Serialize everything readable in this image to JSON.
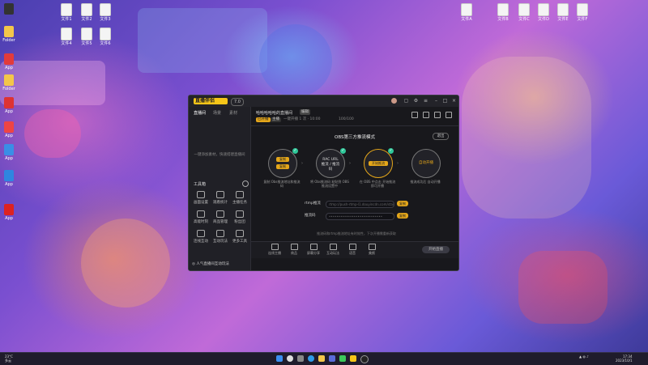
{
  "desktop": {
    "icons_left": [
      {
        "label": "",
        "kind": "app",
        "color": "#333333"
      },
      {
        "label": "Folder",
        "kind": "folder",
        "color": "#f3c64a"
      },
      {
        "label": "App",
        "kind": "app",
        "color": "#e23b3b"
      },
      {
        "label": "Folder",
        "kind": "folder",
        "color": "#f3c64a"
      },
      {
        "label": "App",
        "kind": "app",
        "color": "#d33"
      },
      {
        "label": "App",
        "kind": "app",
        "color": "#e44"
      },
      {
        "label": "App",
        "kind": "app",
        "color": "#3a8ee6"
      },
      {
        "label": "App",
        "kind": "app",
        "color": "#2f86e0"
      },
      {
        "label": "App",
        "kind": "app",
        "color": "#d22"
      }
    ],
    "icons_top": [
      "文件1",
      "文件2",
      "文件3",
      "文件4",
      "文件5",
      "文件6"
    ],
    "icons_right": [
      "文件A",
      "文件B",
      "文件C",
      "文件D",
      "文件E",
      "文件F"
    ]
  },
  "window": {
    "app_name": "直播伴侣",
    "version_badge": "7.0",
    "sidebar": {
      "tabs": [
        "直播间",
        "场景",
        "素材"
      ],
      "empty_text": "一键添加素材，快速搭建直播间",
      "tools_title": "工具箱",
      "tools": [
        "画面设置",
        "观看统计",
        "主播任务",
        "高能时刻",
        "商品管理",
        "粉丝团",
        "连线互动",
        "互动玩法",
        "更多工具"
      ],
      "footer_text": "◎ 人气直播间互动玩法"
    },
    "header": {
      "title": "哈哈哈哈哈的直播间",
      "tag": "编辑",
      "chips": [
        "已开播",
        "主播"
      ],
      "meta": "一键开播 1 次 · 10:00",
      "stat": "100/100"
    },
    "mode": {
      "title": "OBS第三方推流模式",
      "exit_label": "退出",
      "steps": [
        {
          "inner": "",
          "buttons": [
            "复制",
            "复制"
          ],
          "label": "复制 Obs推流地址和推流码"
        },
        {
          "inner": "RAC URL 推流 / 推流码",
          "buttons": [],
          "label": "将 Obs推流码 粘贴到 OBS 推流设置中"
        },
        {
          "inner": "开始推流",
          "buttons": [],
          "label": "在 OBS 中点击 开始推流 即可开播"
        },
        {
          "inner": "自动开播",
          "buttons": [],
          "label": "推流成功后 自动开播"
        }
      ],
      "arrow": "›",
      "url_label": "rtmp推流",
      "url_value": "rtmp://push-rtmp-l1.douyincdn.com/stage/",
      "url_copy": "复制",
      "key_label": "推流码",
      "key_value": "••••••••••••••••••••••••••••",
      "key_copy": "复制",
      "hint": "推流码和rtmp推流地址有时效性，下次开播需重新获取"
    },
    "bottom_bar": {
      "items": [
        "连线主播",
        "商品",
        "屏幕分享",
        "互动玩法",
        "语音",
        "美颜"
      ],
      "start_label": "开始直播"
    }
  },
  "taskbar": {
    "weather_temp": "23°C",
    "weather_text": "多云",
    "time": "17:34",
    "date": "2023/10/1"
  }
}
